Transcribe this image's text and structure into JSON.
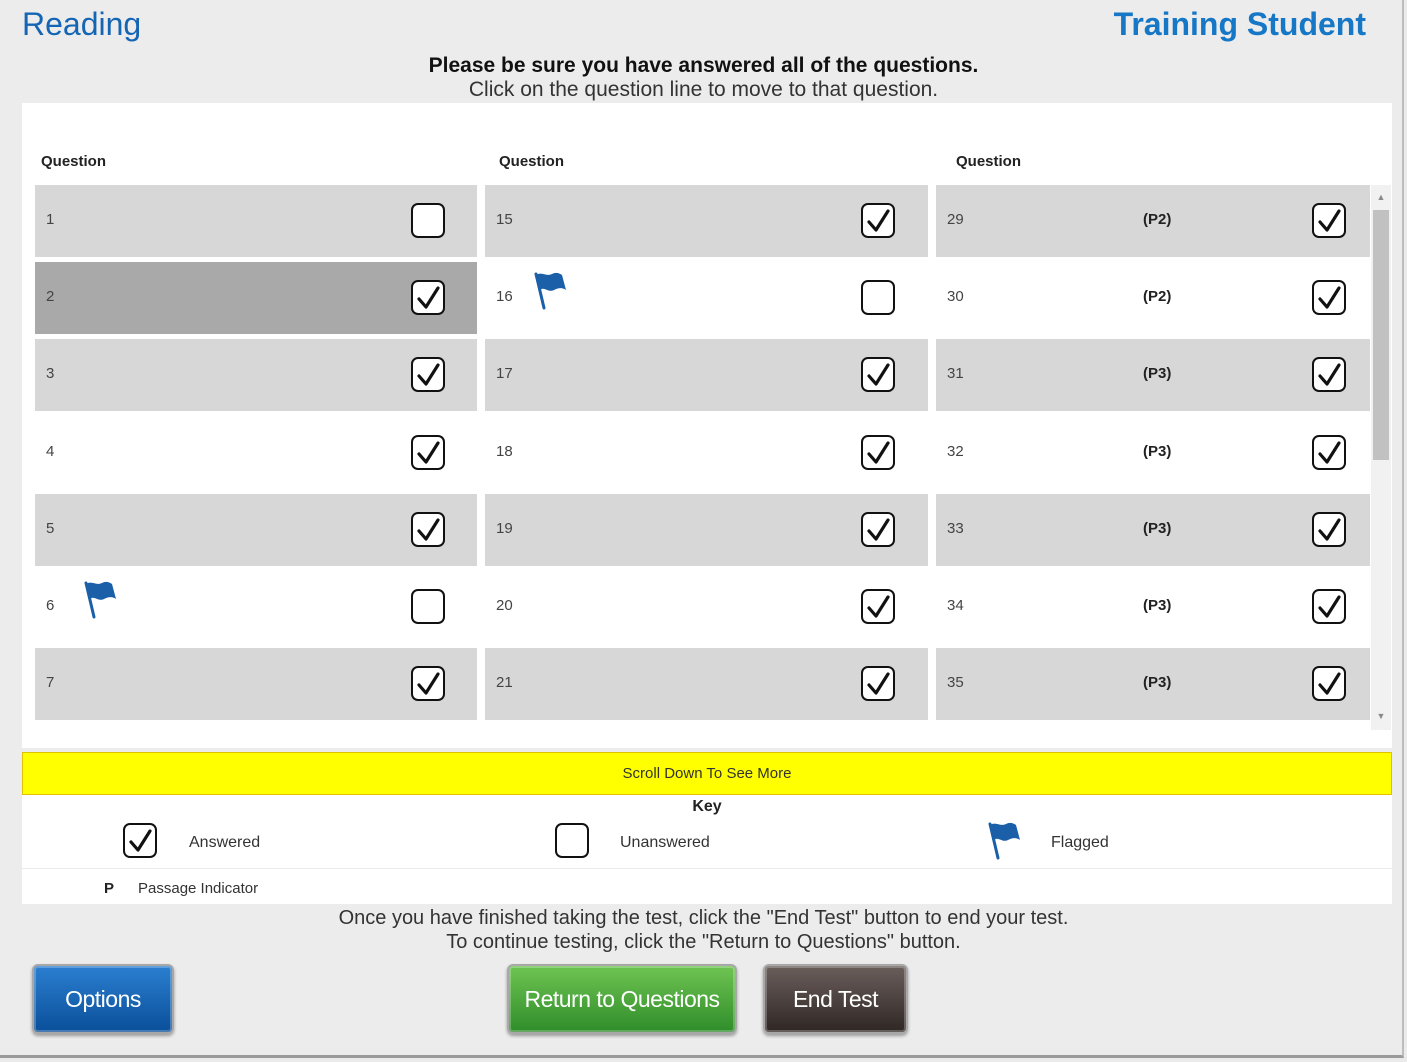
{
  "header": {
    "subject": "Reading",
    "student": "Training Student"
  },
  "instructions": {
    "line1": "Please be sure you have answered all of the questions.",
    "line2": "Click on the question line to move to that question."
  },
  "columns": [
    {
      "header": "Question"
    },
    {
      "header": "Question"
    },
    {
      "header": "Question"
    }
  ],
  "questions": [
    {
      "number": "1",
      "answered": false,
      "flagged": false,
      "passage": "",
      "selected": false
    },
    {
      "number": "2",
      "answered": true,
      "flagged": false,
      "passage": "",
      "selected": true
    },
    {
      "number": "3",
      "answered": true,
      "flagged": false,
      "passage": "",
      "selected": false
    },
    {
      "number": "4",
      "answered": true,
      "flagged": false,
      "passage": "",
      "selected": false
    },
    {
      "number": "5",
      "answered": true,
      "flagged": false,
      "passage": "",
      "selected": false
    },
    {
      "number": "6",
      "answered": false,
      "flagged": true,
      "passage": "",
      "selected": false
    },
    {
      "number": "7",
      "answered": true,
      "flagged": false,
      "passage": "",
      "selected": false
    },
    {
      "number": "15",
      "answered": true,
      "flagged": false,
      "passage": "",
      "selected": false
    },
    {
      "number": "16",
      "answered": false,
      "flagged": true,
      "passage": "",
      "selected": false
    },
    {
      "number": "17",
      "answered": true,
      "flagged": false,
      "passage": "",
      "selected": false
    },
    {
      "number": "18",
      "answered": true,
      "flagged": false,
      "passage": "",
      "selected": false
    },
    {
      "number": "19",
      "answered": true,
      "flagged": false,
      "passage": "",
      "selected": false
    },
    {
      "number": "20",
      "answered": true,
      "flagged": false,
      "passage": "",
      "selected": false
    },
    {
      "number": "21",
      "answered": true,
      "flagged": false,
      "passage": "",
      "selected": false
    },
    {
      "number": "29",
      "answered": true,
      "flagged": false,
      "passage": "(P2)",
      "selected": false
    },
    {
      "number": "30",
      "answered": true,
      "flagged": false,
      "passage": "(P2)",
      "selected": false
    },
    {
      "number": "31",
      "answered": true,
      "flagged": false,
      "passage": "(P3)",
      "selected": false
    },
    {
      "number": "32",
      "answered": true,
      "flagged": false,
      "passage": "(P3)",
      "selected": false
    },
    {
      "number": "33",
      "answered": true,
      "flagged": false,
      "passage": "(P3)",
      "selected": false
    },
    {
      "number": "34",
      "answered": true,
      "flagged": false,
      "passage": "(P3)",
      "selected": false
    },
    {
      "number": "35",
      "answered": true,
      "flagged": false,
      "passage": "(P3)",
      "selected": false
    }
  ],
  "scroll_banner": "Scroll Down To See More",
  "key": {
    "title": "Key",
    "answered": "Answered",
    "unanswered": "Unanswered",
    "flagged": "Flagged",
    "passage_symbol": "P",
    "passage_label": "Passage Indicator"
  },
  "end_info": {
    "line1": "Once you have finished taking the test, click the \"End Test\" button to end your test.",
    "line2": "To continue testing, click the \"Return to Questions\" button."
  },
  "buttons": {
    "options": "Options",
    "return": "Return to Questions",
    "end": "End Test"
  },
  "colors": {
    "accent_blue": "#1565b5",
    "flag_blue": "#1a5fa8",
    "banner_yellow": "#ffff00",
    "options_blue": "#0a4f9a",
    "return_green": "#2f8d2a",
    "end_dark": "#2f2724"
  },
  "icons": {
    "answered": "checkbox-checked-icon",
    "unanswered": "checkbox-empty-icon",
    "flagged": "flag-icon"
  }
}
